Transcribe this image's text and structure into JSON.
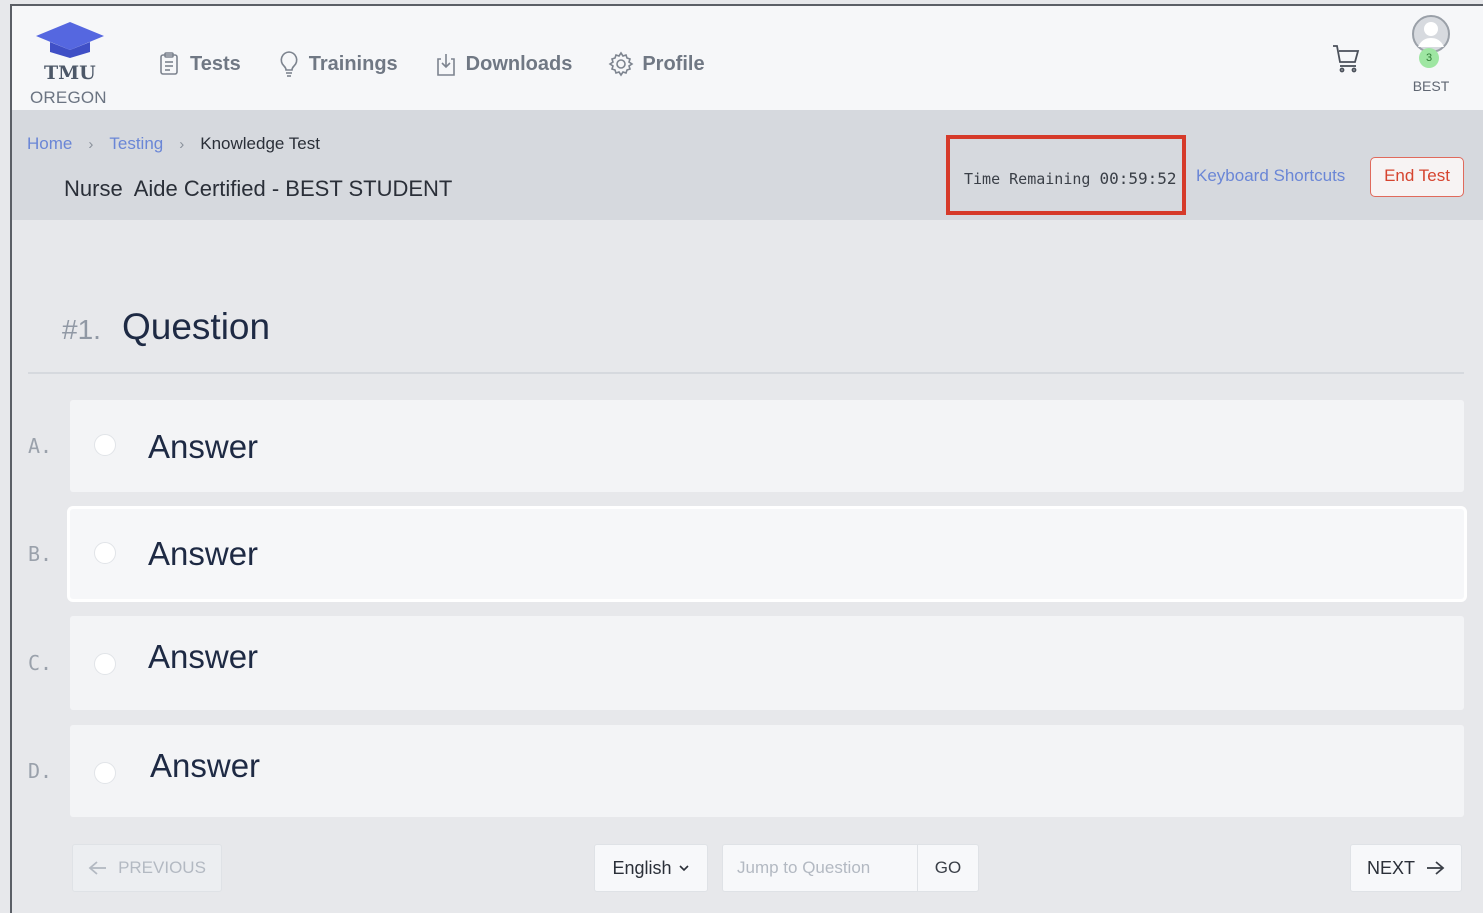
{
  "brand": {
    "line1": "TMU",
    "line2": "OREGON",
    "accent": "#5567e0"
  },
  "nav": [
    {
      "label": "Tests",
      "icon": "clipboard-icon"
    },
    {
      "label": "Trainings",
      "icon": "lightbulb-icon"
    },
    {
      "label": "Downloads",
      "icon": "download-icon"
    },
    {
      "label": "Profile",
      "icon": "gear-icon"
    }
  ],
  "user": {
    "badge_count": "3",
    "name": "BEST"
  },
  "breadcrumb": {
    "home": "Home",
    "testing": "Testing",
    "current": "Knowledge Test"
  },
  "test_title": "Nurse  Aide Certified - BEST STUDENT",
  "timer": {
    "label": "Time Remaining",
    "value": "00:59:52"
  },
  "header_actions": {
    "keyboard_shortcuts": "Keyboard Shortcuts",
    "end_test": "End Test"
  },
  "question": {
    "number": "#1.",
    "text": "Question",
    "answers": [
      {
        "letter": "A.",
        "text": "Answer"
      },
      {
        "letter": "B.",
        "text": "Answer"
      },
      {
        "letter": "C.",
        "text": "Answer"
      },
      {
        "letter": "D.",
        "text": "Answer"
      }
    ]
  },
  "footer": {
    "previous": "PREVIOUS",
    "language": "English",
    "jump_placeholder": "Jump to Question",
    "go": "GO",
    "next": "NEXT"
  },
  "colors": {
    "link": "#6a86d6",
    "end_test": "#d6442f",
    "highlight_box": "#d63a2a"
  }
}
